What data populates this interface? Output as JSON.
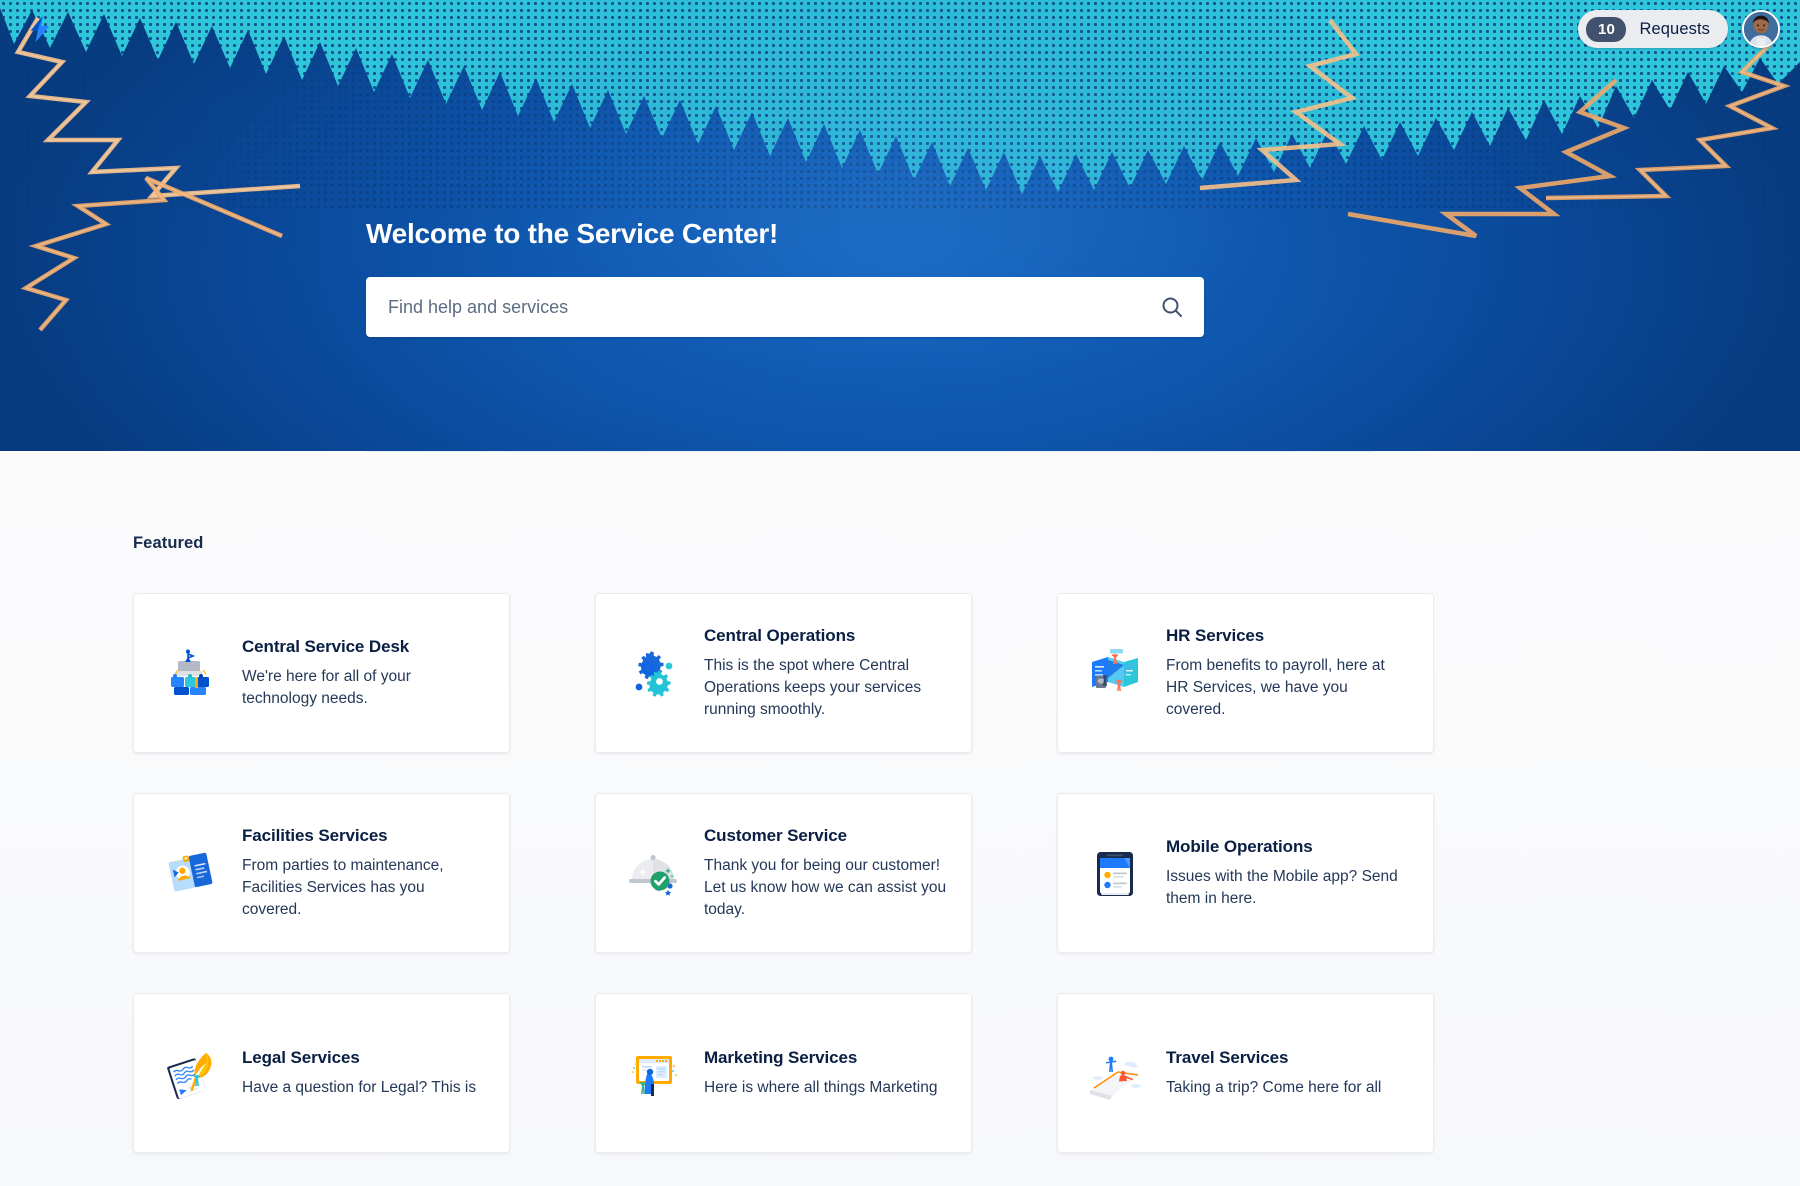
{
  "topbar": {
    "logo_icon": "jira-lightning-logo-icon",
    "requests": {
      "count": "10",
      "label": "Requests"
    },
    "avatar_label": "user-avatar"
  },
  "hero": {
    "title": "Welcome to the Service Center!",
    "search": {
      "placeholder": "Find help and services",
      "value": "",
      "icon": "search-icon"
    }
  },
  "main": {
    "section_title": "Featured",
    "cards": [
      {
        "title": "Central Service Desk",
        "desc": "We're here for all of your technology needs.",
        "icon": "blocks-person-icon"
      },
      {
        "title": "Central Operations",
        "desc": "This is the spot where Central Operations keeps your services running smoothly.",
        "icon": "gears-icon"
      },
      {
        "title": "HR Services",
        "desc": "From benefits to payroll, here at HR Services, we have you covered.",
        "icon": "hr-panels-icon"
      },
      {
        "title": "Facilities Services",
        "desc": "From parties to maintenance, Facilities Services has you covered.",
        "icon": "id-badge-icon"
      },
      {
        "title": "Customer Service",
        "desc": "Thank you for being our customer! Let us know how we can assist you today.",
        "icon": "cloche-check-icon"
      },
      {
        "title": "Mobile Operations",
        "desc": "Issues with the Mobile app? Send them in here.",
        "icon": "mobile-device-icon"
      },
      {
        "title": "Legal Services",
        "desc": "Have a question for Legal? This is",
        "icon": "legal-quill-icon"
      },
      {
        "title": "Marketing Services",
        "desc": "Here is where all things Marketing",
        "icon": "presentation-board-icon"
      },
      {
        "title": "Travel Services",
        "desc": "Taking a trip? Come here for all",
        "icon": "airplane-wing-icon"
      }
    ]
  },
  "colors": {
    "hero_blue": "#0d56ad",
    "teal": "#2bc8d9",
    "accent_orange": "#f0a868",
    "brand_blue": "#0052cc",
    "text": "#172b4d"
  }
}
